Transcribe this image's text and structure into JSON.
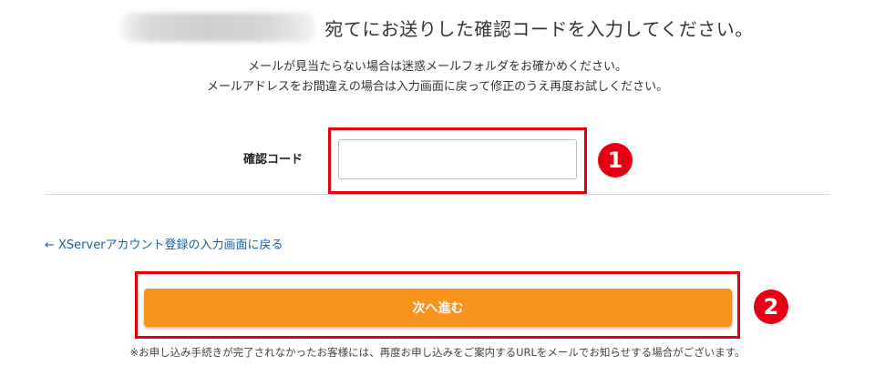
{
  "heading": {
    "text": "宛てにお送りした確認コードを入力してください。"
  },
  "notes": {
    "line1": "メールが見当たらない場合は迷惑メールフォルダをお確かめください。",
    "line2": "メールアドレスをお間違えの場合は入力画面に戻って修正のうえ再度お試しください。"
  },
  "form": {
    "code_label": "確認コード",
    "code_value": "",
    "code_placeholder": ""
  },
  "annotations": {
    "badge1": "1",
    "badge2": "2",
    "highlight_color": "#e60012"
  },
  "back_link": {
    "label": "← XServerアカウント登録の入力画面に戻る",
    "color": "#1a5fa8"
  },
  "submit": {
    "label": "次へ進む",
    "color": "#f7931e"
  },
  "footnote": "※お申し込み手続きが完了されなかったお客様には、再度お申し込みをご案内するURLをメールでお知らせする場合がございます。"
}
